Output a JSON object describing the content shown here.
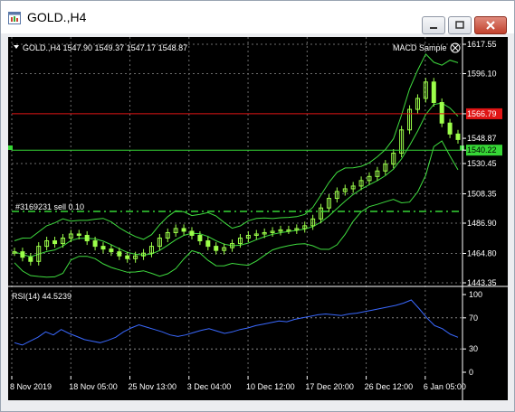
{
  "window": {
    "title": "GOLD.,H4"
  },
  "main_panel": {
    "header": "GOLD.,H4  1547.90 1549.37 1547.17 1548.87",
    "indicator_label": "MACD Sample",
    "trade_label": "#3169231 sell 0.10",
    "price_labels": [
      "1617.55",
      "1596.10",
      "1566.79",
      "1548.87",
      "1540.22",
      "1530.45",
      "1508.35",
      "1486.90",
      "1464.80",
      "1443.35"
    ],
    "red_level_price": "1566.79",
    "green_level_price": "1540.22",
    "current_price": "1548.87"
  },
  "rsi_panel": {
    "header": "RSI(14) 44.5239",
    "scale_labels": [
      "100",
      "70",
      "30",
      "0"
    ]
  },
  "time_axis": [
    "8 Nov 2019",
    "18 Nov 05:00",
    "25 Nov 13:00",
    "3 Dec 04:00",
    "10 Dec 12:00",
    "17 Dec 20:00",
    "26 Dec 12:00",
    "6 Jan 05:00"
  ],
  "colors": {
    "background": "#000000",
    "candles": "#9cff4a",
    "bollinger": "#3fdc3f",
    "red_level": "#e01515",
    "green_level": "#36d636",
    "rsi_line": "#3a69ff",
    "grid": "#6e6e6e",
    "axis_text": "#ffffff"
  },
  "chart_data": {
    "type": "line",
    "title": "GOLD.,H4",
    "y_range": [
      1443.35,
      1617.55
    ],
    "x_labels": [
      "8 Nov 2019",
      "18 Nov 05:00",
      "25 Nov 13:00",
      "3 Dec 04:00",
      "10 Dec 12:00",
      "17 Dec 20:00",
      "26 Dec 12:00",
      "6 Jan 05:00"
    ],
    "series": [
      {
        "name": "GOLD.,H4",
        "values": [
          1466,
          1462,
          1459,
          1470,
          1474,
          1472,
          1476,
          1479,
          1478,
          1474,
          1470,
          1468,
          1466,
          1463,
          1461,
          1463,
          1465,
          1470,
          1476,
          1480,
          1483,
          1481,
          1478,
          1474,
          1470,
          1467,
          1469,
          1472,
          1476,
          1478,
          1479,
          1480,
          1481,
          1482,
          1482,
          1483,
          1485,
          1490,
          1498,
          1505,
          1510,
          1512,
          1514,
          1518,
          1521,
          1525,
          1530,
          1538,
          1555,
          1570,
          1578,
          1590,
          1575,
          1560,
          1552,
          1548
        ]
      }
    ],
    "levels": [
      {
        "price": 1566.79
      },
      {
        "price": 1540.22
      }
    ],
    "rsi": {
      "name": "RSI(14)",
      "range": [
        0,
        100
      ],
      "levels": [
        70,
        30
      ],
      "values": [
        38,
        35,
        40,
        45,
        52,
        48,
        55,
        50,
        46,
        42,
        40,
        38,
        41,
        45,
        52,
        57,
        61,
        58,
        55,
        52,
        48,
        46,
        48,
        51,
        54,
        56,
        53,
        50,
        52,
        55,
        57,
        60,
        62,
        64,
        66,
        65,
        68,
        70,
        72,
        74,
        75,
        74,
        73,
        75,
        76,
        78,
        80,
        82,
        84,
        86,
        89,
        93,
        82,
        70,
        60,
        56,
        49,
        45
      ]
    },
    "grid": true
  }
}
